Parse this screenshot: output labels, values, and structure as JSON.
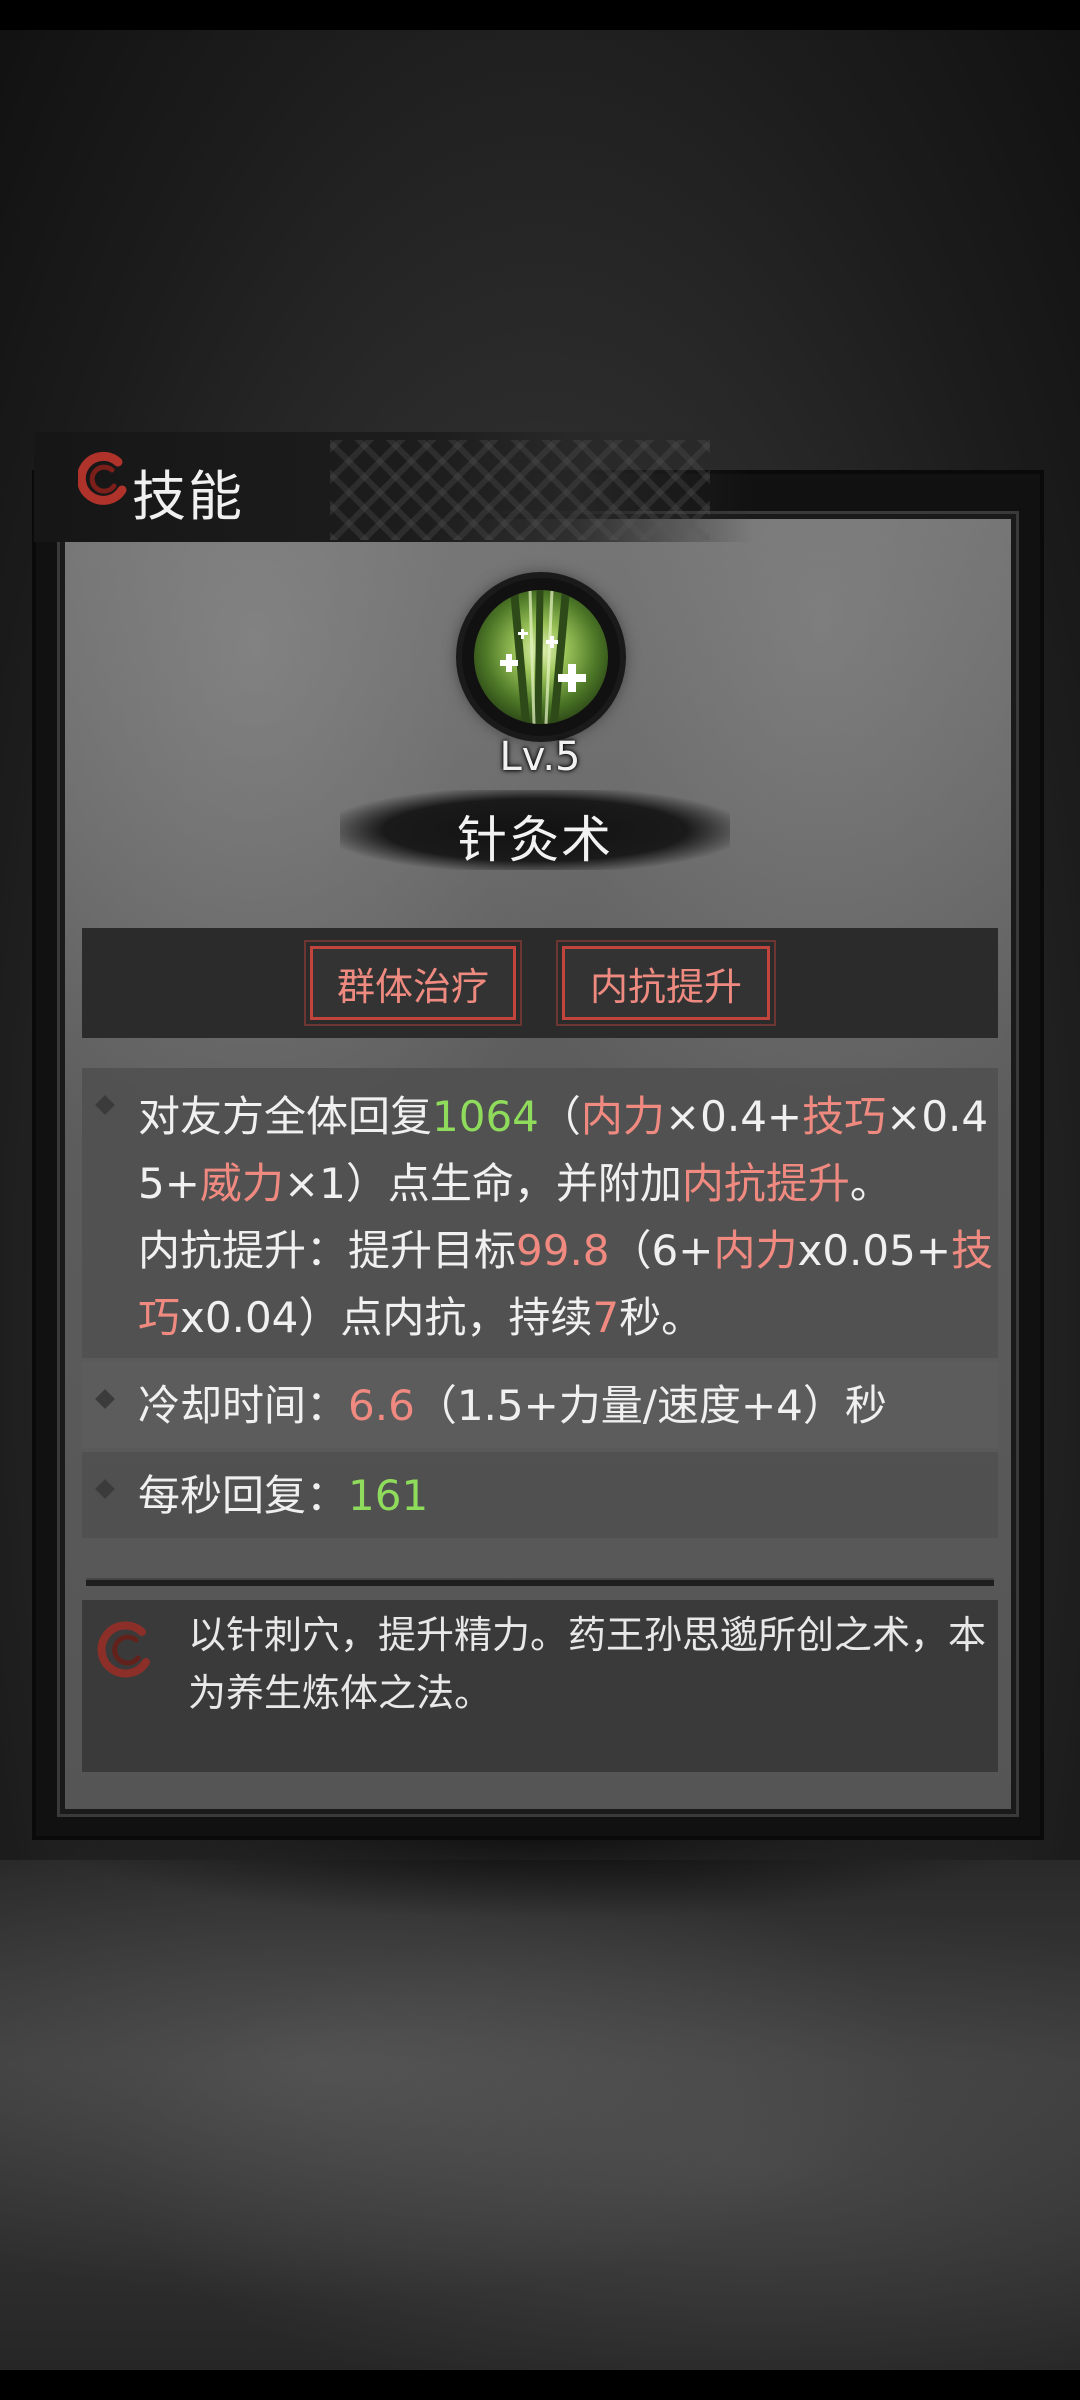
{
  "dialog": {
    "title": "技能"
  },
  "skill": {
    "level": "Lv.5",
    "name": "针灸术",
    "tags": [
      "群体治疗",
      "内抗提升"
    ]
  },
  "description": {
    "effect_parts": [
      {
        "text": "对友方全体回复",
        "style": "n"
      },
      {
        "text": "1064",
        "style": "g"
      },
      {
        "text": "（",
        "style": "n"
      },
      {
        "text": "内力",
        "style": "r"
      },
      {
        "text": "×0.4+",
        "style": "n"
      },
      {
        "text": "技巧",
        "style": "r"
      },
      {
        "text": "×0.45+",
        "style": "n"
      },
      {
        "text": "威力",
        "style": "r"
      },
      {
        "text": "×1）点生命，并附加",
        "style": "n"
      },
      {
        "text": "内抗提升",
        "style": "r"
      },
      {
        "text": "。",
        "style": "n"
      }
    ],
    "buff_parts": [
      {
        "text": "内抗提升：提升目标",
        "style": "n"
      },
      {
        "text": "99.8",
        "style": "r"
      },
      {
        "text": "（6+",
        "style": "n"
      },
      {
        "text": "内力",
        "style": "r"
      },
      {
        "text": "x0.05+",
        "style": "n"
      },
      {
        "text": "技巧",
        "style": "r"
      },
      {
        "text": "x0.04）点内抗，持续",
        "style": "n"
      },
      {
        "text": "7",
        "style": "r"
      },
      {
        "text": "秒。",
        "style": "n"
      }
    ],
    "cooldown": {
      "label": "冷却时间：",
      "value": "6.6",
      "formula": "（1.5+力量/速度+4）秒"
    },
    "regen": {
      "label": "每秒回复：",
      "value": "161"
    }
  },
  "flavor_text": "以针刺穴，提升精力。药王孙思邈所创之术，本为养生炼体之法。",
  "colors": {
    "green_value": "#8fdc5c",
    "red_keyword": "#f08a80",
    "tag_border": "#c2453d"
  }
}
